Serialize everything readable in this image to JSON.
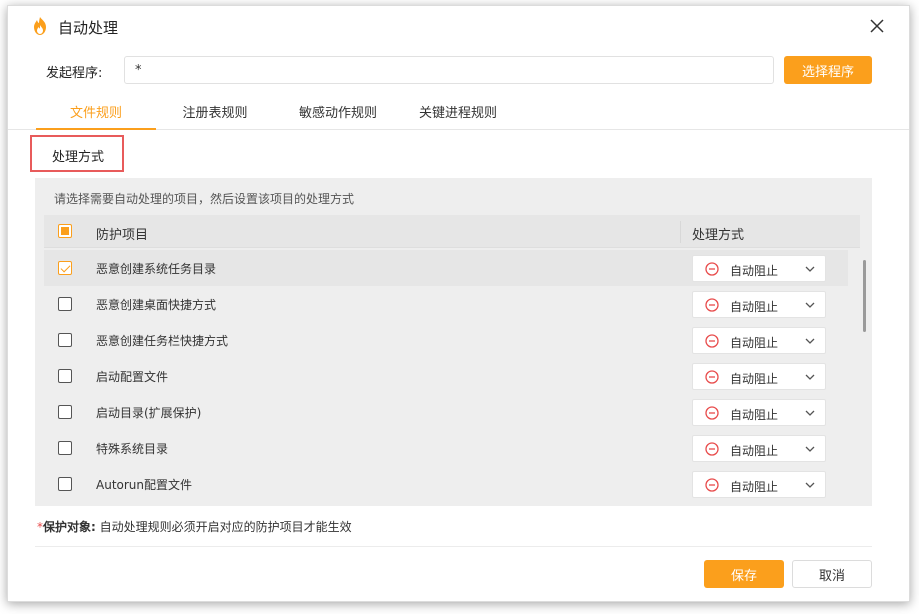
{
  "window": {
    "title": "自动处理",
    "close_icon": "close-icon",
    "app_icon": "flame-shield-icon"
  },
  "launch": {
    "label": "发起程序:",
    "value": "*",
    "select_button": "选择程序"
  },
  "tabs": [
    {
      "label": "文件规则",
      "active": true
    },
    {
      "label": "注册表规则",
      "active": false
    },
    {
      "label": "敏感动作规则",
      "active": false
    },
    {
      "label": "关键进程规则",
      "active": false
    }
  ],
  "section": {
    "title": "处理方式"
  },
  "panel": {
    "hint": "请选择需要自动处理的项目，然后设置该项目的处理方式",
    "header_item": "防护项目",
    "header_mode": "处理方式",
    "rows": [
      {
        "label": "恶意创建系统任务目录",
        "mode": "自动阻止",
        "checked": true
      },
      {
        "label": "恶意创建桌面快捷方式",
        "mode": "自动阻止",
        "checked": false
      },
      {
        "label": "恶意创建任务栏快捷方式",
        "mode": "自动阻止",
        "checked": false
      },
      {
        "label": "启动配置文件",
        "mode": "自动阻止",
        "checked": false
      },
      {
        "label": "启动目录(扩展保护)",
        "mode": "自动阻止",
        "checked": false
      },
      {
        "label": "特殊系统目录",
        "mode": "自动阻止",
        "checked": false
      },
      {
        "label": "Autorun配置文件",
        "mode": "自动阻止",
        "checked": false
      }
    ]
  },
  "note": {
    "star": "*",
    "label": "保护对象:",
    "text": "自动处理规则必须开启对应的防护项目才能生效"
  },
  "footer": {
    "save": "保存",
    "cancel": "取消"
  },
  "colors": {
    "accent": "#fb9f1c",
    "highlight_border": "#e85b5b",
    "block_icon": "#e84b4b"
  }
}
